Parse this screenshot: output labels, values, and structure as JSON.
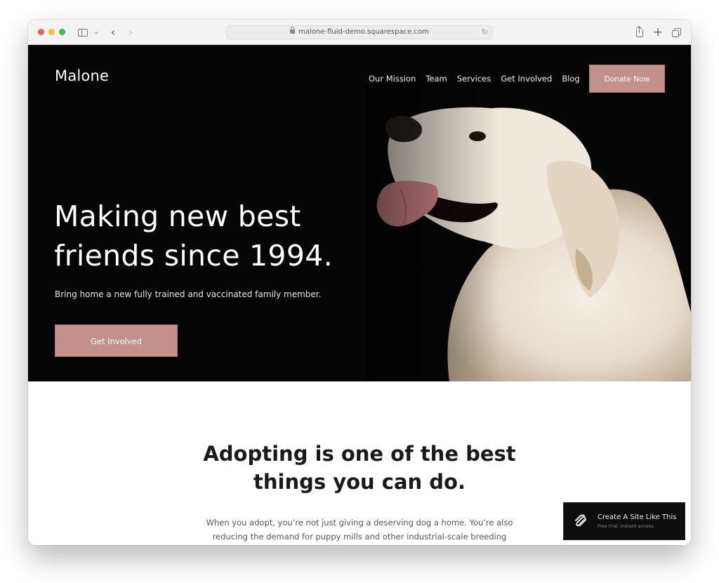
{
  "browser": {
    "url": "malone-fluid-demo.squarespace.com",
    "icons": {
      "sidebar": "sidebar-icon",
      "chevron": "chevron-down-icon",
      "back": "‹",
      "forward": "›",
      "reload": "↻",
      "share": "share-icon",
      "new_tab": "+",
      "tabs": "tab-overview-icon"
    }
  },
  "site": {
    "title": "Malone",
    "nav": [
      "Our Mission",
      "Team",
      "Services",
      "Get Involved",
      "Blog"
    ],
    "donate_label": "Donate Now",
    "accent_color": "#c4908a"
  },
  "hero": {
    "title_line1": "Making new best",
    "title_line2": "friends since 1994.",
    "subtitle": "Bring home a new fully trained and vaccinated family member.",
    "cta_label": "Get Involved",
    "image": "golden-retriever-photo"
  },
  "intro": {
    "title_line1": "Adopting is one of the best",
    "title_line2": "things you can do.",
    "body_line1": "When you adopt, you’re not just giving a deserving dog a home. You’re also",
    "body_line2": "reducing the demand for puppy mills and other industrial-scale breeding"
  },
  "squarespace_badge": {
    "title": "Create A Site Like This",
    "subtitle": "Free trial. Instant access."
  }
}
